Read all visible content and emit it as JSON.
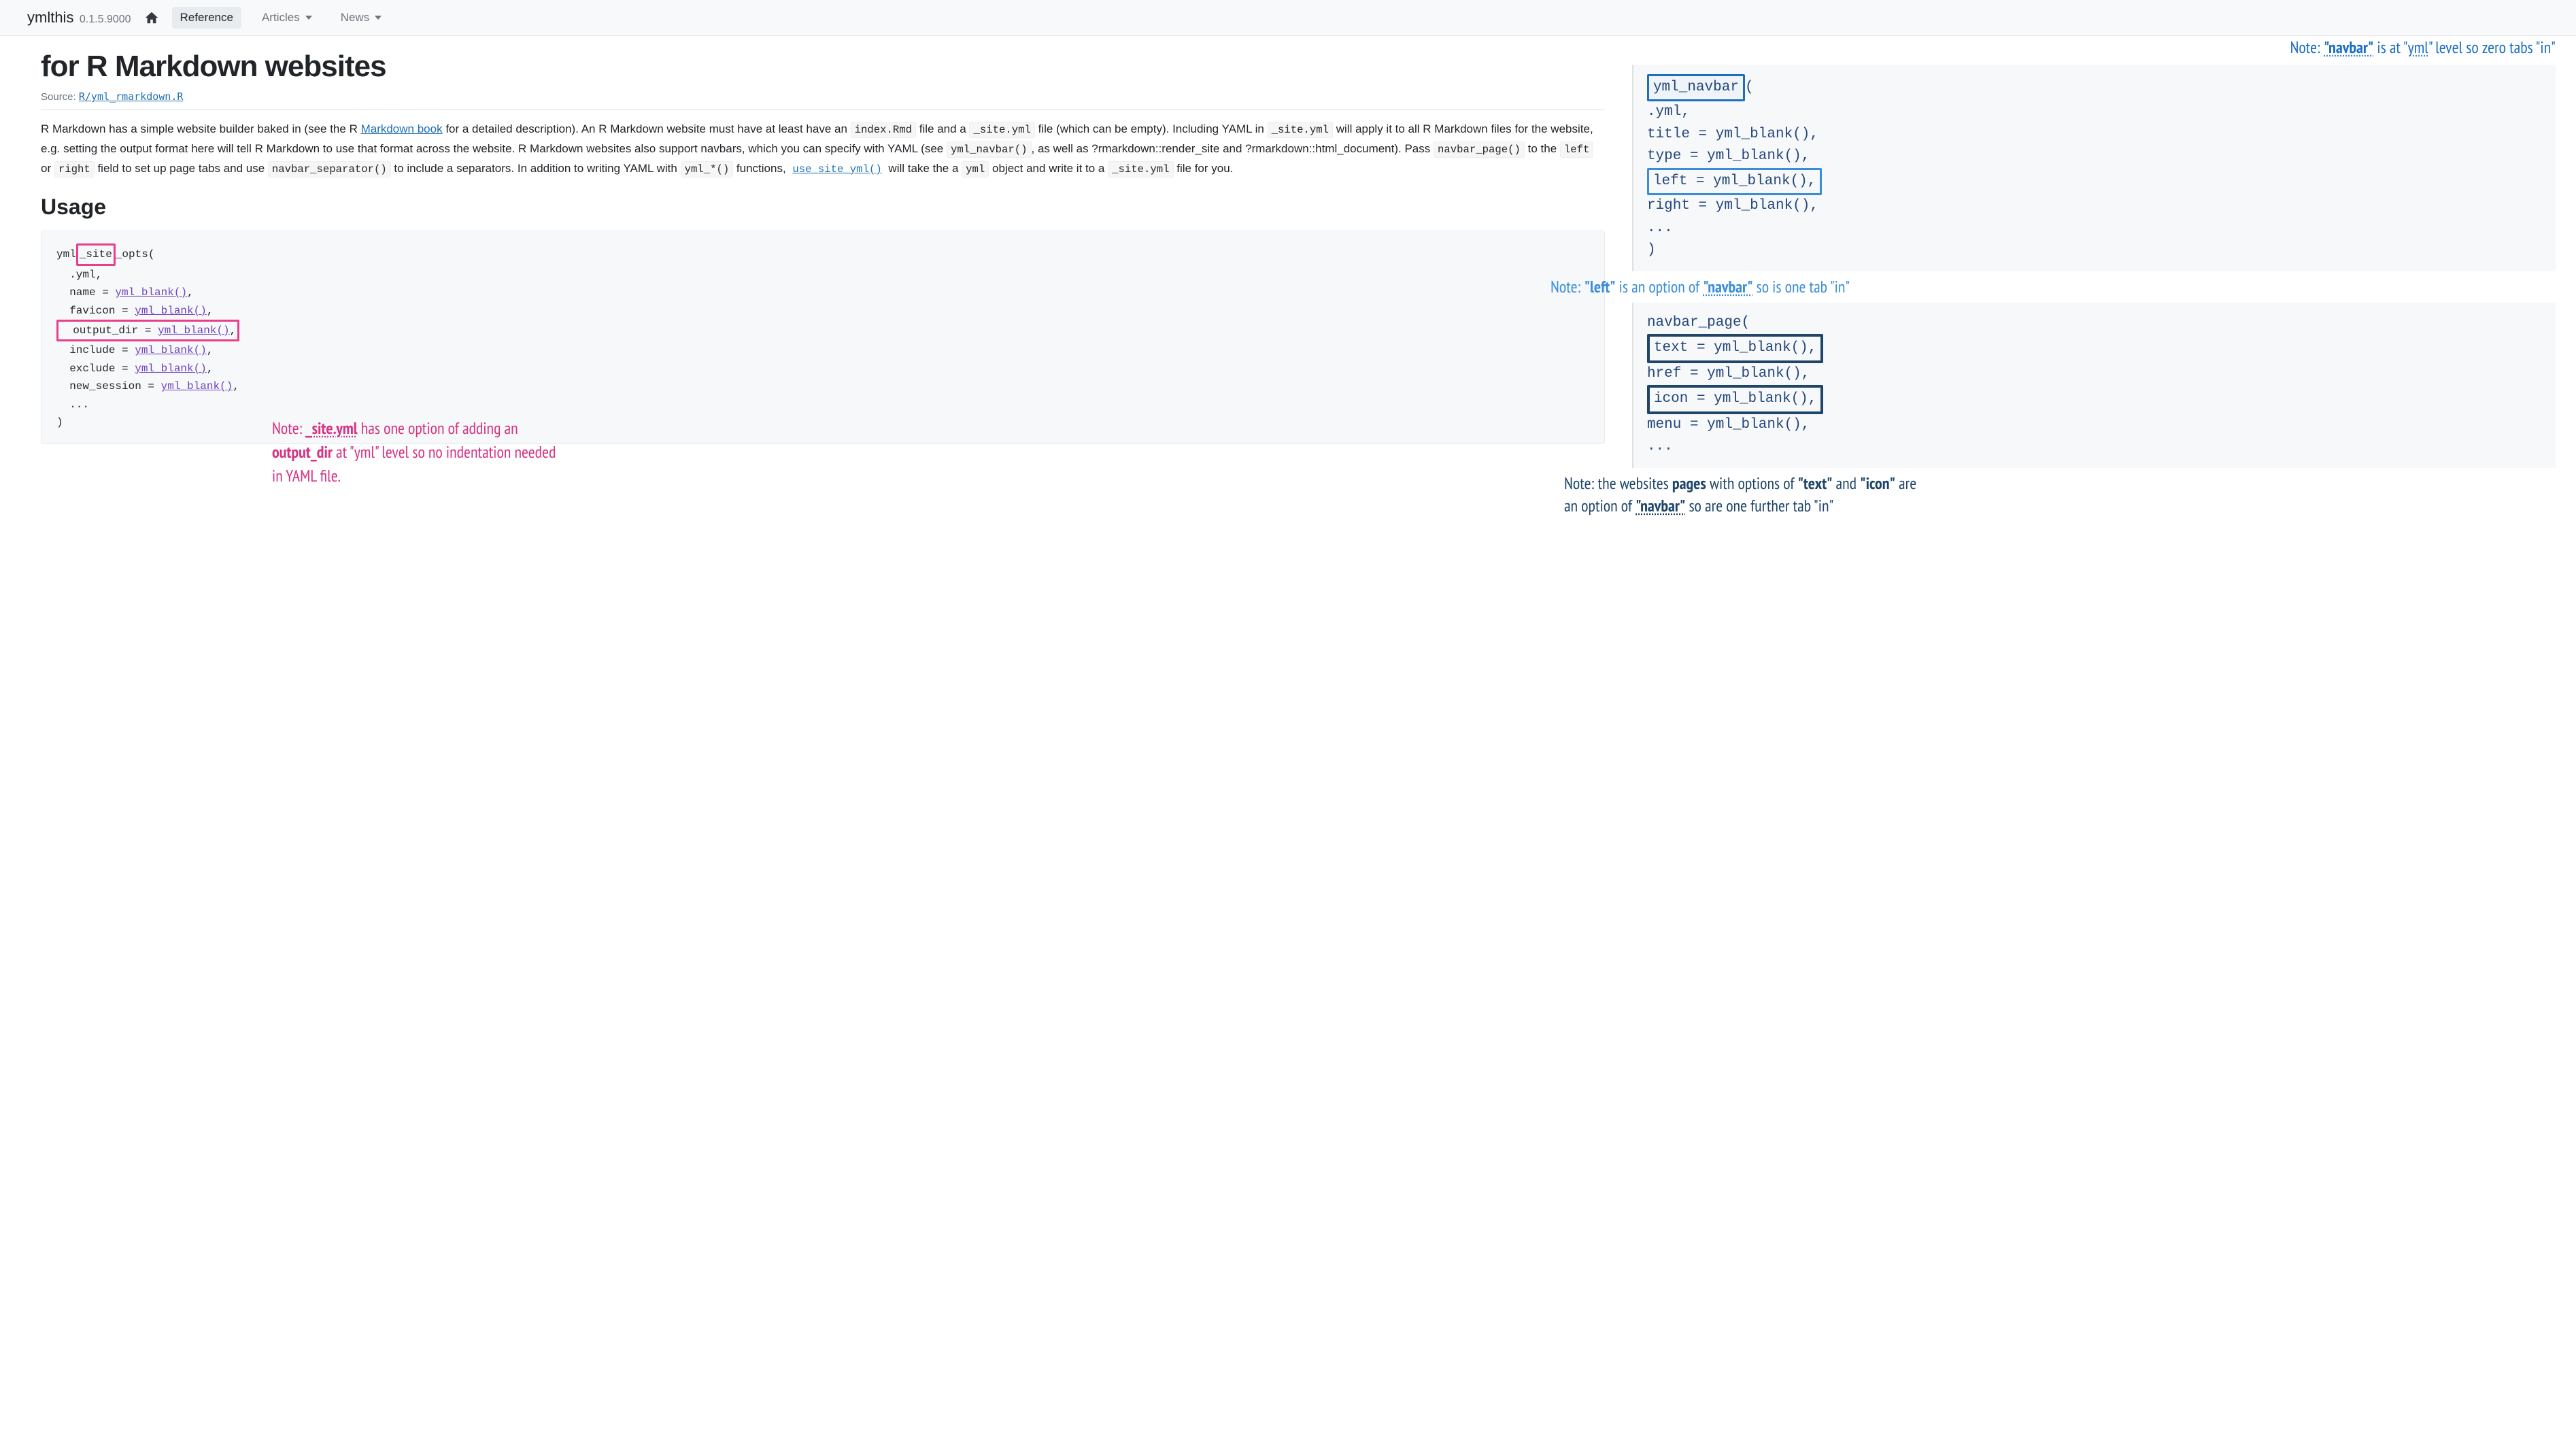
{
  "nav": {
    "brand": "ymlthis",
    "version": "0.1.5.9000",
    "reference": "Reference",
    "articles": "Articles",
    "news": "News"
  },
  "page": {
    "title": "for R Markdown websites",
    "source_label": "Source:",
    "source_link": "R/yml_rmarkdown.R",
    "body_p1a": "R Markdown has a simple website builder baked in (see the R ",
    "body_link1": "Markdown book",
    "body_p1b": " for a detailed description). An R Markdown website must have at least have an ",
    "code_index": "index.Rmd",
    "body_p1c": " file and a ",
    "code_siteyml1": "_site.yml",
    "body_p1d": " file (which can be empty). Including YAML in ",
    "code_siteyml2": "_site.yml",
    "body_p1e": " will apply it to all R Markdown files for the website, e.g. setting the output format here will tell R Markdown to use that format across the website. R Markdown websites also support navbars, which you can specify with YAML (see ",
    "code_navbar": "yml_navbar()",
    "body_p1f": ", as well as ?rmarkdown::render_site and ?rmarkdown::html_document). Pass ",
    "code_navpage": "navbar_page()",
    "body_p1g": " to the ",
    "code_left": "left",
    "body_p1h": " or ",
    "code_right": "right",
    "body_p1i": " field to set up page tabs and use ",
    "code_sep": "navbar_separator()",
    "body_p1j": " to include a separators. In addition to writing YAML with ",
    "code_ymlstar": "yml_*()",
    "body_p1k": " functions, ",
    "link_use": "use_site_yml()",
    "body_p1l": " will take the a ",
    "code_yml": "yml",
    "body_p1m": " object and write it to a ",
    "code_siteyml3": "_site.yml",
    "body_p1n": " file for you."
  },
  "usage": {
    "heading": "Usage",
    "pre1": "yml",
    "pre_site": "_site",
    "pre_opts": "_opts(",
    "line_yml": "  .yml,",
    "line_name": "  name = ",
    "blank": "yml_blank()",
    "comma": ",",
    "line_fav": "  favicon = ",
    "line_out": "  output_dir = ",
    "line_inc": "  include = ",
    "line_exc": "  exclude = ",
    "line_new": "  new_session = ",
    "line_dots": "  ...",
    "line_close": ")"
  },
  "annotations": {
    "pink": {
      "p1": "Note: ",
      "site": "_site.yml",
      "p2": " has one option of adding an ",
      "outdir": "output_dir",
      "p3": " at \"yml\" level so no indentation needed in YAML file."
    },
    "teal": {
      "p1": "Note: ",
      "navbar": "\"navbar\"",
      "p2": " is at \"",
      "yml": "yml",
      "p3": "\" level so zero tabs \"in\""
    },
    "sky": {
      "p1": "Note: ",
      "left": "\"left\"",
      "p2": " is an option of ",
      "navbar": "\"navbar\"",
      "p3": " so is one tab \"in\""
    },
    "navy": {
      "p1": "Note: the websites ",
      "pages": "pages",
      "p2": " with options of ",
      "text": "\"text\"",
      "p3": " and ",
      "icon": "\"icon\"",
      "p4": " are an option of ",
      "navbar": "\"navbar\"",
      "p5": " so are one further tab \"in\""
    }
  },
  "right_code": {
    "navbar_open": "yml_navbar",
    "paren": "(",
    "indent_yml": "  .yml,",
    "title": "  title = yml_blank(),",
    "type": "  type = yml_blank(),",
    "left_line": "  left = yml_blank(),",
    "right_line": "  right = yml_blank(),",
    "dots": "  ...",
    "close": ")",
    "page_open": "navbar_page(",
    "text_line": "  text = yml_blank(),",
    "href_line": "  href = yml_blank(),",
    "icon_line": "  icon = yml_blank(),",
    "menu_line": "  menu = yml_blank(),",
    "dots2": "  ..."
  }
}
